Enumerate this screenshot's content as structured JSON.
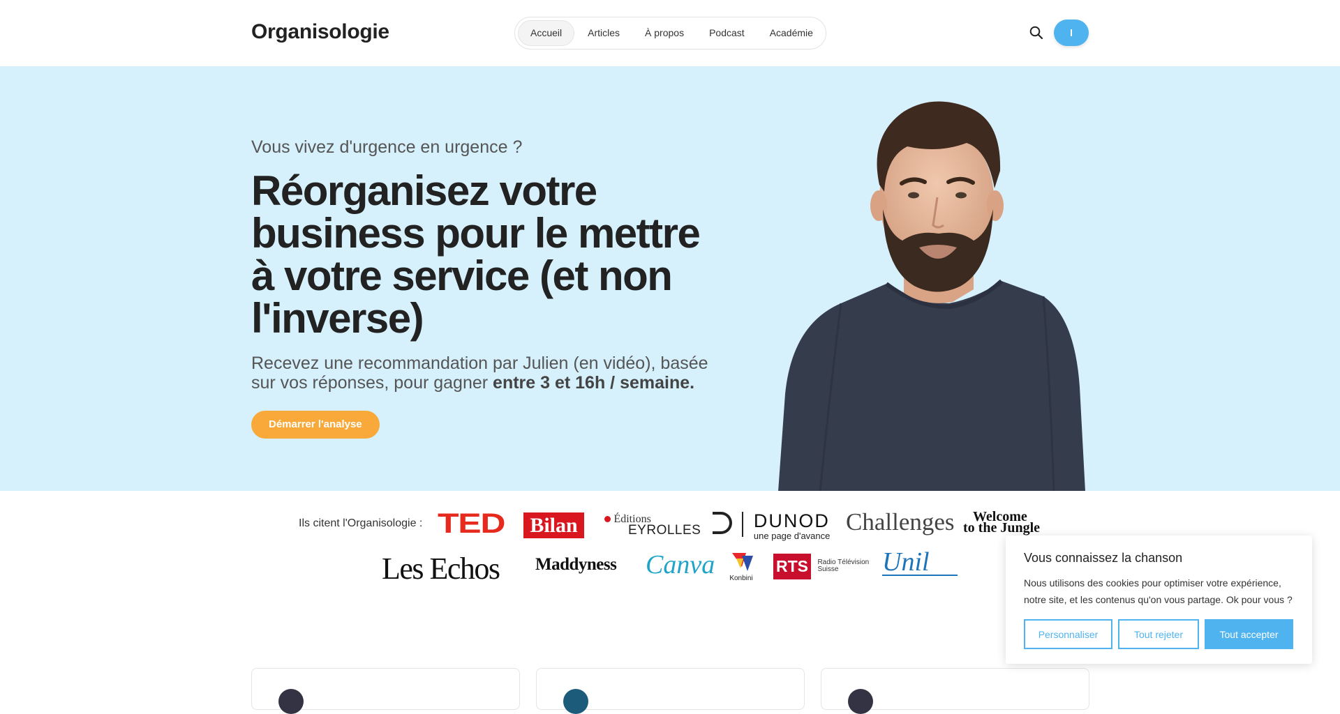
{
  "header": {
    "logo": "Organisologie",
    "nav": [
      "Accueil",
      "Articles",
      "À propos",
      "Podcast",
      "Académie"
    ],
    "active_nav": "Accueil"
  },
  "hero": {
    "kicker": "Vous vivez d'urgence en urgence ?",
    "headline": "Réorganisez votre business pour le mettre à votre service (et non l'inverse)",
    "sub_pre": "Recevez une recommandation par Julien (en vidéo), basée sur vos réponses, pour gagner ",
    "sub_bold": "entre 3 et 16h / semaine.",
    "cta": "Démarrer l'analyse"
  },
  "press": {
    "label": "Ils citent l'Organisologie :",
    "logos": {
      "ted": "TED",
      "bilan": "Bilan",
      "eyrolles_top": "Éditions",
      "eyrolles": "EYROLLES",
      "dunod": "DUNOD",
      "dunod_tag": "une page d'avance",
      "challenges": "Challenges",
      "wttj_1": "Welcome",
      "wttj_2": "to the Jungle",
      "lesechos": "Les Echos",
      "maddyness": "Maddyness",
      "canva": "Canva",
      "konbini": "Konbini",
      "rts": "RTS",
      "rts_tag_1": "Radio Télévision",
      "rts_tag_2": "Suisse",
      "unil": "Unil"
    }
  },
  "cookie": {
    "title": "Vous connaissez la chanson",
    "text": "Nous utilisons des cookies pour optimiser votre expérience, notre site, et les contenus qu'on vous partage. Ok pour vous ?",
    "customize": "Personnaliser",
    "reject": "Tout rejeter",
    "accept": "Tout accepter"
  },
  "colors": {
    "hero_bg": "#d6f0fc",
    "accent_blue": "#4fb3ef",
    "cta_orange": "#f8a93a"
  }
}
